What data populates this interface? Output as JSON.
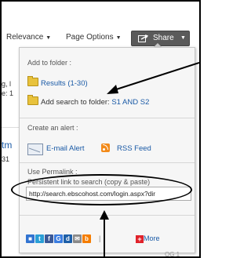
{
  "toolbar": {
    "relevance_label": "Relevance",
    "page_options_label": "Page Options",
    "share_label": "Share"
  },
  "background_fragments": {
    "line1": "g, l",
    "line2": "e: 1",
    "line3": "tm",
    "line4": "31"
  },
  "dropdown": {
    "add_to_folder": {
      "title": "Add to folder :",
      "results_label": "Results (1-30)",
      "add_search_prefix": "Add search to folder:",
      "add_search_target": "S1 AND S2"
    },
    "create_alert": {
      "title": "Create an alert :",
      "email_label": "E-mail Alert",
      "rss_label": "RSS Feed"
    },
    "permalink": {
      "title": "Use Permalink :",
      "description": "Persistent link to search (copy & paste)",
      "url_value": "http://search.ebscohost.com/login.aspx?dir"
    },
    "social": {
      "separator": "|",
      "more_label": "More",
      "icons": [
        {
          "name": "delicious",
          "color": "#3274d1",
          "glyph": "■"
        },
        {
          "name": "twitter",
          "color": "#2a9fd6",
          "glyph": "t"
        },
        {
          "name": "facebook",
          "color": "#3b5998",
          "glyph": "f"
        },
        {
          "name": "google",
          "color": "#3b7de0",
          "glyph": "G"
        },
        {
          "name": "digg",
          "color": "#1d5fa8",
          "glyph": "d"
        },
        {
          "name": "mail",
          "color": "#8a8a8a",
          "glyph": "✉"
        },
        {
          "name": "blogger",
          "color": "#f57d00",
          "glyph": "b"
        }
      ],
      "more_color": "#e0222a"
    }
  },
  "bottom_fragment": "OG 1"
}
